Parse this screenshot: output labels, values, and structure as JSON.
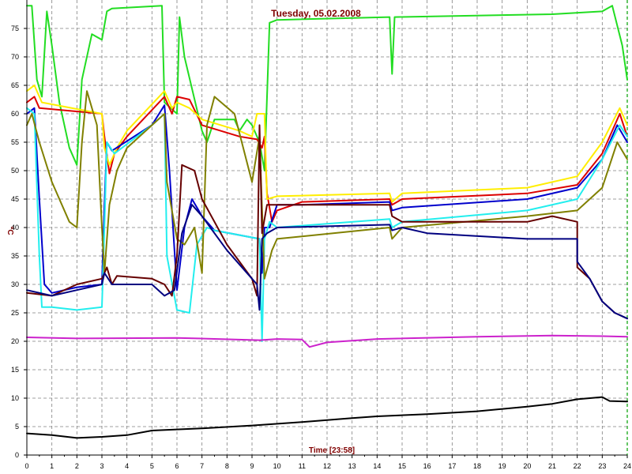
{
  "chart_data": {
    "type": "line",
    "title": "Tuesday, 05.02.2008",
    "xlabel": "Time [23:58]",
    "ylabel": "°C",
    "xlim": [
      0,
      24
    ],
    "ylim": [
      0,
      80
    ],
    "x_ticks": [
      0,
      1,
      2,
      3,
      4,
      5,
      6,
      7,
      8,
      9,
      10,
      11,
      12,
      13,
      14,
      15,
      16,
      17,
      18,
      19,
      20,
      21,
      22,
      23,
      24
    ],
    "y_ticks": [
      0,
      5,
      10,
      15,
      20,
      25,
      30,
      35,
      40,
      45,
      50,
      55,
      60,
      65,
      70,
      75
    ],
    "grid": true,
    "legend": "none",
    "colors": {
      "title": "#800000",
      "axis_label": "#800000",
      "grid": "#808080",
      "background": "#ffffff",
      "right_marker": "#00a000"
    },
    "series": [
      {
        "color": "#22dd22",
        "points": [
          [
            0,
            79
          ],
          [
            0.2,
            79
          ],
          [
            0.4,
            66
          ],
          [
            0.6,
            63
          ],
          [
            0.8,
            78
          ],
          [
            1,
            72
          ],
          [
            1.3,
            62
          ],
          [
            1.7,
            54
          ],
          [
            2,
            51
          ],
          [
            2.2,
            66
          ],
          [
            2.6,
            74
          ],
          [
            3,
            73
          ],
          [
            3.2,
            78
          ],
          [
            3.4,
            78.5
          ],
          [
            5.4,
            79
          ],
          [
            5.5,
            62
          ],
          [
            6,
            60
          ],
          [
            6.1,
            77
          ],
          [
            6.3,
            70
          ],
          [
            7,
            57
          ],
          [
            7.2,
            55
          ],
          [
            7.5,
            59
          ],
          [
            8.3,
            59
          ],
          [
            8.5,
            57
          ],
          [
            8.8,
            59
          ],
          [
            9,
            58
          ],
          [
            9.3,
            55
          ],
          [
            9.5,
            50
          ],
          [
            9.7,
            76
          ],
          [
            10,
            76.5
          ],
          [
            14.5,
            77
          ],
          [
            14.6,
            67
          ],
          [
            14.7,
            77
          ],
          [
            21,
            77.5
          ],
          [
            23,
            78
          ],
          [
            23.4,
            79
          ],
          [
            23.8,
            72
          ],
          [
            24,
            66
          ]
        ]
      },
      {
        "color": "#dd0000",
        "points": [
          [
            0,
            62
          ],
          [
            0.3,
            63
          ],
          [
            0.5,
            61
          ],
          [
            3,
            60
          ],
          [
            3.1,
            56
          ],
          [
            3.3,
            49.5
          ],
          [
            3.5,
            53
          ],
          [
            4,
            56
          ],
          [
            5.5,
            63
          ],
          [
            5.8,
            60
          ],
          [
            6,
            63
          ],
          [
            6.5,
            62.5
          ],
          [
            7,
            58
          ],
          [
            8.5,
            56
          ],
          [
            9.2,
            55.5
          ],
          [
            9.4,
            54
          ],
          [
            9.5,
            56
          ],
          [
            9.6,
            46
          ],
          [
            9.8,
            41
          ],
          [
            10,
            43
          ],
          [
            11,
            44.5
          ],
          [
            14.5,
            45
          ],
          [
            14.6,
            44
          ],
          [
            15,
            45
          ],
          [
            20,
            46
          ],
          [
            22,
            47.5
          ],
          [
            23,
            53
          ],
          [
            23.7,
            60
          ],
          [
            24,
            56
          ]
        ]
      },
      {
        "color": "#ffee00",
        "points": [
          [
            0,
            64
          ],
          [
            0.3,
            65
          ],
          [
            0.6,
            62
          ],
          [
            3,
            60
          ],
          [
            3.1,
            54
          ],
          [
            3.3,
            51
          ],
          [
            3.6,
            54
          ],
          [
            4,
            57
          ],
          [
            5.5,
            64
          ],
          [
            5.8,
            61
          ],
          [
            6,
            62
          ],
          [
            6.5,
            61
          ],
          [
            7,
            59
          ],
          [
            8.5,
            57
          ],
          [
            9,
            56
          ],
          [
            9.2,
            60
          ],
          [
            9.5,
            60
          ],
          [
            9.6,
            45
          ],
          [
            10,
            45.5
          ],
          [
            14.5,
            46
          ],
          [
            14.6,
            44.5
          ],
          [
            15,
            46
          ],
          [
            20,
            47
          ],
          [
            22,
            49
          ],
          [
            23,
            55
          ],
          [
            23.7,
            61
          ],
          [
            24,
            58
          ]
        ]
      },
      {
        "color": "#0000cc",
        "points": [
          [
            0,
            60
          ],
          [
            0.3,
            61
          ],
          [
            0.5,
            45
          ],
          [
            0.7,
            30
          ],
          [
            1,
            28.5
          ],
          [
            2,
            29.5
          ],
          [
            3,
            30
          ],
          [
            3.1,
            44
          ],
          [
            3.2,
            55
          ],
          [
            3.4,
            53.5
          ],
          [
            5,
            58
          ],
          [
            5.5,
            61.5
          ],
          [
            5.7,
            50
          ],
          [
            6,
            29
          ],
          [
            6.3,
            40
          ],
          [
            6.6,
            45
          ],
          [
            7,
            42
          ],
          [
            7.5,
            39.5
          ],
          [
            9.3,
            38
          ],
          [
            9.4,
            32
          ],
          [
            9.5,
            40
          ],
          [
            9.7,
            40
          ],
          [
            10,
            44
          ],
          [
            11,
            44
          ],
          [
            14.5,
            44.5
          ],
          [
            14.6,
            43
          ],
          [
            15,
            43.5
          ],
          [
            20,
            45
          ],
          [
            22,
            47
          ],
          [
            23,
            52
          ],
          [
            23.6,
            58
          ],
          [
            24,
            55
          ]
        ]
      },
      {
        "color": "#22eeee",
        "points": [
          [
            0,
            61
          ],
          [
            0.3,
            60
          ],
          [
            0.5,
            35
          ],
          [
            0.6,
            26
          ],
          [
            1,
            26
          ],
          [
            2,
            25.5
          ],
          [
            3,
            26
          ],
          [
            3.1,
            40
          ],
          [
            3.2,
            55
          ],
          [
            3.5,
            53
          ],
          [
            5,
            58
          ],
          [
            5.5,
            60
          ],
          [
            5.6,
            35
          ],
          [
            6,
            25.5
          ],
          [
            6.5,
            25
          ],
          [
            6.8,
            37
          ],
          [
            7.2,
            40
          ],
          [
            7.5,
            39.5
          ],
          [
            9.3,
            38
          ],
          [
            9.4,
            20
          ],
          [
            9.5,
            38
          ],
          [
            9.7,
            41
          ],
          [
            10,
            40
          ],
          [
            14.5,
            41.5
          ],
          [
            14.6,
            40
          ],
          [
            15,
            41
          ],
          [
            20,
            43
          ],
          [
            22,
            45
          ],
          [
            23,
            52
          ],
          [
            23.7,
            58
          ],
          [
            24,
            56
          ]
        ]
      },
      {
        "color": "#808000",
        "points": [
          [
            0,
            58
          ],
          [
            0.2,
            60
          ],
          [
            0.5,
            55
          ],
          [
            1,
            48
          ],
          [
            1.7,
            41
          ],
          [
            2,
            40
          ],
          [
            2.2,
            55
          ],
          [
            2.4,
            64
          ],
          [
            2.8,
            58
          ],
          [
            3,
            40
          ],
          [
            3.1,
            32
          ],
          [
            3.3,
            44
          ],
          [
            3.6,
            50
          ],
          [
            4,
            54
          ],
          [
            5.5,
            60
          ],
          [
            5.6,
            48
          ],
          [
            6,
            38
          ],
          [
            6.3,
            37
          ],
          [
            6.7,
            40
          ],
          [
            7,
            32
          ],
          [
            7.2,
            58
          ],
          [
            7.5,
            63
          ],
          [
            8.3,
            60
          ],
          [
            9,
            48
          ],
          [
            9.3,
            56
          ],
          [
            9.5,
            31
          ],
          [
            9.8,
            36
          ],
          [
            10,
            38
          ],
          [
            14.5,
            40
          ],
          [
            14.6,
            38
          ],
          [
            15,
            40
          ],
          [
            20,
            42
          ],
          [
            22,
            43
          ],
          [
            23,
            47
          ],
          [
            23.6,
            55
          ],
          [
            24,
            52
          ]
        ]
      },
      {
        "color": "#660000",
        "points": [
          [
            0,
            28.5
          ],
          [
            1,
            28
          ],
          [
            2,
            30
          ],
          [
            3,
            31
          ],
          [
            3.1,
            32
          ],
          [
            3.2,
            33
          ],
          [
            3.4,
            30
          ],
          [
            3.6,
            31.5
          ],
          [
            5,
            31
          ],
          [
            5.5,
            30
          ],
          [
            5.8,
            28
          ],
          [
            6,
            35
          ],
          [
            6.2,
            51
          ],
          [
            6.7,
            50
          ],
          [
            7,
            45
          ],
          [
            8,
            37
          ],
          [
            9,
            31
          ],
          [
            9.2,
            28
          ],
          [
            9.3,
            58
          ],
          [
            9.4,
            39
          ],
          [
            9.6,
            44
          ],
          [
            10,
            44
          ],
          [
            14.5,
            44
          ],
          [
            14.6,
            42
          ],
          [
            15,
            41
          ],
          [
            20,
            41
          ],
          [
            21,
            42
          ],
          [
            22,
            41
          ],
          [
            22,
            33
          ],
          [
            22.5,
            31
          ],
          [
            23,
            27
          ],
          [
            23.5,
            25
          ],
          [
            24,
            24
          ]
        ]
      },
      {
        "color": "#000080",
        "points": [
          [
            0,
            29
          ],
          [
            1,
            28
          ],
          [
            2,
            29
          ],
          [
            3,
            30
          ],
          [
            3.1,
            32
          ],
          [
            3.4,
            30
          ],
          [
            5,
            30
          ],
          [
            5.5,
            28
          ],
          [
            5.9,
            29
          ],
          [
            6.2,
            39
          ],
          [
            6.6,
            44
          ],
          [
            7,
            42
          ],
          [
            8,
            36
          ],
          [
            9,
            31
          ],
          [
            9.2,
            30
          ],
          [
            9.3,
            25.5
          ],
          [
            9.4,
            38
          ],
          [
            9.6,
            39
          ],
          [
            10,
            40
          ],
          [
            14.5,
            40.5
          ],
          [
            14.6,
            39.5
          ],
          [
            15,
            40
          ],
          [
            16,
            39
          ],
          [
            20,
            38
          ],
          [
            22,
            38
          ],
          [
            22,
            34
          ],
          [
            22.5,
            31
          ],
          [
            23,
            27
          ],
          [
            23.5,
            25
          ],
          [
            24,
            24
          ]
        ]
      },
      {
        "color": "#cc22cc",
        "points": [
          [
            0,
            20.7
          ],
          [
            2,
            20.5
          ],
          [
            6,
            20.6
          ],
          [
            9.3,
            20.2
          ],
          [
            10,
            20.4
          ],
          [
            11,
            20.3
          ],
          [
            11.3,
            19.0
          ],
          [
            12,
            19.8
          ],
          [
            14,
            20.4
          ],
          [
            18,
            20.8
          ],
          [
            21,
            21.0
          ],
          [
            23,
            20.9
          ],
          [
            24,
            20.8
          ]
        ]
      },
      {
        "color": "#000000",
        "points": [
          [
            0,
            3.8
          ],
          [
            1,
            3.5
          ],
          [
            2,
            3.0
          ],
          [
            3,
            3.2
          ],
          [
            4,
            3.5
          ],
          [
            5,
            4.3
          ],
          [
            7,
            4.7
          ],
          [
            9,
            5.2
          ],
          [
            11,
            5.8
          ],
          [
            13,
            6.5
          ],
          [
            14,
            6.8
          ],
          [
            16,
            7.2
          ],
          [
            18,
            7.7
          ],
          [
            20,
            8.5
          ],
          [
            21,
            9.0
          ],
          [
            22,
            9.8
          ],
          [
            23,
            10.2
          ],
          [
            23.3,
            9.5
          ],
          [
            24,
            9.4
          ]
        ]
      }
    ]
  }
}
